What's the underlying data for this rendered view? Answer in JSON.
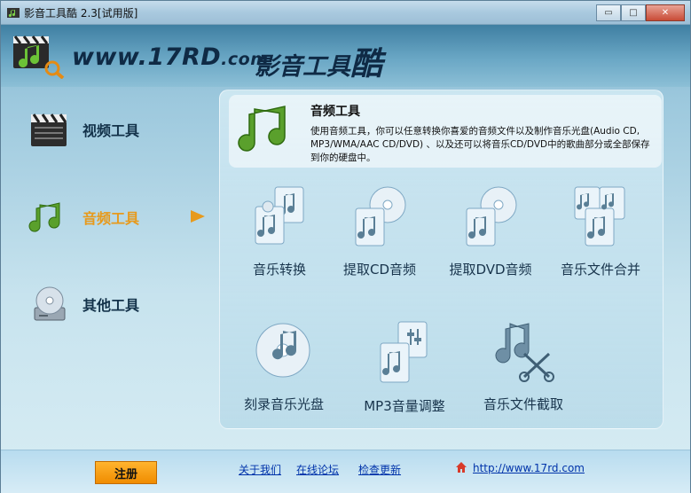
{
  "window": {
    "title": "影音工具酷 2.3[试用版]",
    "controls": {
      "minimize": "▭",
      "maximize": "□",
      "close": "✕"
    }
  },
  "banner": {
    "site_prefix": "www.",
    "site_main": "17RD",
    "site_suffix": ".com",
    "app_name_prefix": "影音工具",
    "app_name_last": "酷"
  },
  "nav": {
    "items": [
      {
        "label": "视频工具",
        "icon": "clapperboard-icon"
      },
      {
        "label": "音频工具",
        "icon": "music-note-icon",
        "active": true
      },
      {
        "label": "其他工具",
        "icon": "disc-drive-icon"
      }
    ]
  },
  "panel": {
    "title": "音频工具",
    "description": "使用音频工具，你可以任意转换你喜爱的音频文件以及制作音乐光盘(Audio CD, MP3/WMA/AAC CD/DVD) 、以及还可以将音乐CD/DVD中的歌曲部分或全部保存到你的硬盘中。",
    "tools": [
      {
        "label": "音乐转换"
      },
      {
        "label": "提取CD音频"
      },
      {
        "label": "提取DVD音频"
      },
      {
        "label": "音乐文件合并"
      },
      {
        "label": "刻录音乐光盘"
      },
      {
        "label": "MP3音量调整"
      },
      {
        "label": "音乐文件截取"
      }
    ]
  },
  "footer": {
    "register": "注册",
    "about": "关于我们",
    "forum": "在线论坛",
    "update": "检查更新",
    "url": "http://www.17rd.com"
  },
  "colors": {
    "accent": "#e79a1c",
    "music_green": "#5aa02c",
    "link": "#0033aa"
  }
}
